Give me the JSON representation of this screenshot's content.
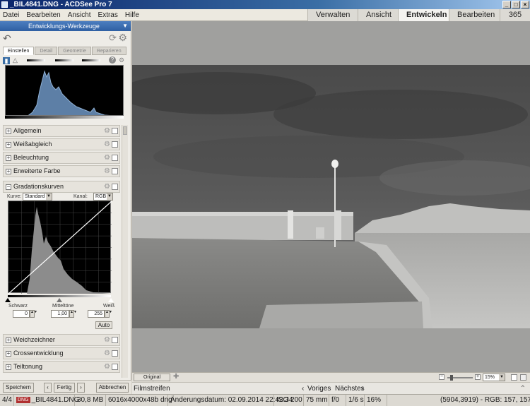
{
  "window": {
    "title": "_BIL4841.DNG - ACDSee Pro 7"
  },
  "menu": [
    "Datei",
    "Bearbeiten",
    "Ansicht",
    "Extras",
    "Hilfe"
  ],
  "modes": [
    "Verwalten",
    "Ansicht",
    "Entwickeln",
    "Bearbeiten",
    "365"
  ],
  "active_mode": "Entwickeln",
  "panel": {
    "title": "Entwicklungs-Werkzeuge",
    "subtabs": [
      "Einstellen",
      "Detail",
      "Geometrie",
      "Reparieren"
    ],
    "sections_top": [
      "Allgemein",
      "Weißabgleich",
      "Beleuchtung",
      "Erweiterte Farbe"
    ],
    "curves": {
      "title": "Gradationskurven",
      "curve_label": "Kurve:",
      "curve_value": "Standard",
      "channel_label": "Kanal:",
      "channel_value": "RGB",
      "black_label": "Schwarz",
      "mid_label": "Mitteltöne",
      "white_label": "Weiß",
      "black_value": "0",
      "mid_value": "1,00",
      "white_value": "255",
      "auto_label": "Auto"
    },
    "sections_bottom": [
      "Weichzeichner",
      "Crossentwicklung",
      "Teiltonung"
    ]
  },
  "bottom": {
    "save": "Speichern",
    "done": "Fertig",
    "cancel": "Abbrechen"
  },
  "viewer": {
    "show_original": "Original anzeigen",
    "zoom": "15%",
    "filmstrip": "Filmstreifen",
    "prev": "Voriges",
    "next": "Nächstes"
  },
  "status": {
    "index": "4/4",
    "format": "DNG",
    "filename": "_BIL4841.DNG",
    "filesize": "30,8 MB",
    "dims": "6016x4000x48b dng",
    "modified": "Änderungsdatum: 02.09.2014 22:42:34",
    "iso": "ISO 200",
    "focal": "75 mm",
    "aperture": "f/0",
    "shutter": "1/6 s",
    "zoom": "16%",
    "pixel": "(5904,3919) - RGB: 157, 157, 157"
  }
}
